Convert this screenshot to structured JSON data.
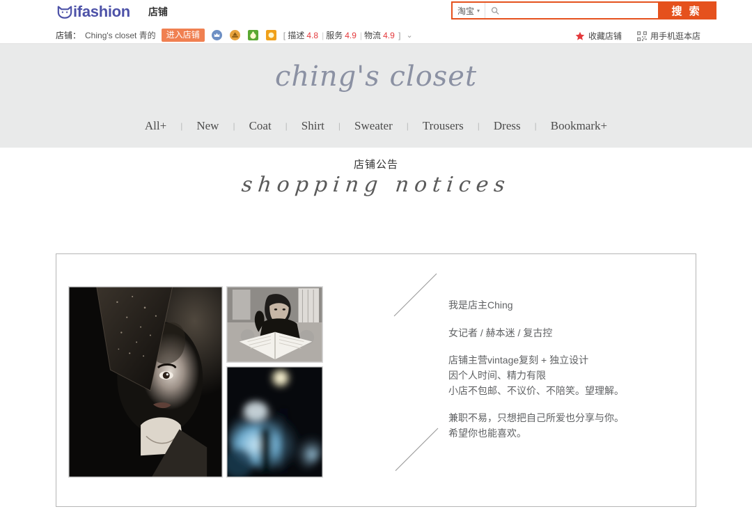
{
  "header": {
    "brand": {
      "name": "ifashion",
      "icon": "cat-face-icon",
      "color": "#4d52a8"
    },
    "shop_tab_label": "店铺",
    "shop_row": {
      "label": "店铺：",
      "name": "Ching's closet 青的",
      "enter_button": "进入店铺"
    },
    "badges": [
      {
        "name": "crown-badge",
        "color": "#6d8fc4"
      },
      {
        "name": "gold-seal-badge",
        "color": "#e8a33d"
      },
      {
        "name": "green-leaf-badge",
        "color": "#5aa832"
      },
      {
        "name": "orange-square-badge",
        "color": "#f0a019"
      }
    ],
    "ratings": {
      "open_bracket": "[",
      "close_bracket": "]",
      "items": [
        {
          "label": "描述",
          "value": "4.8"
        },
        {
          "label": "服务",
          "value": "4.9"
        },
        {
          "label": "物流",
          "value": "4.9"
        }
      ],
      "value_color": "#e4393c"
    },
    "expand_caret": "⌄",
    "search": {
      "category": "淘宝",
      "category_caret": "▾",
      "icon": "search-icon",
      "value": "",
      "placeholder": "",
      "button_label": "搜 索",
      "accent": "#e5511d"
    },
    "right_actions": [
      {
        "icon": "star-icon",
        "label": "收藏店铺"
      },
      {
        "icon": "qr-code-icon",
        "label": "用手机逛本店"
      }
    ]
  },
  "banner": {
    "logo_text": "ching's closet",
    "logo_color": "#8b91a3",
    "background": "#e9eaea",
    "nav": [
      {
        "label": "All+"
      },
      {
        "label": "New"
      },
      {
        "label": "Coat"
      },
      {
        "label": "Shirt"
      },
      {
        "label": "Sweater"
      },
      {
        "label": "Trousers"
      },
      {
        "label": "Dress"
      },
      {
        "label": "Bookmark+"
      }
    ],
    "nav_separator": "|"
  },
  "notice": {
    "title_cn": "店铺公告",
    "title_en": "shopping notices"
  },
  "panel": {
    "photos": [
      {
        "name": "portrait-veiled-hat-photo",
        "alt": "黑白肖像 戴纱帽"
      },
      {
        "name": "reading-book-photo",
        "alt": "黑白照片 阅读书籍"
      },
      {
        "name": "blue-bokeh-night-photo",
        "alt": "蓝色夜景虚焦照片"
      }
    ],
    "text": {
      "line1": "我是店主Ching",
      "line2": "女记者 / 赫本迷 / 复古控",
      "line3": "店铺主营vintage复刻 + 独立设计",
      "line4": "因个人时间、精力有限",
      "line5": "小店不包邮、不议价、不陪笑。望理解。",
      "line6": "兼职不易，只想把自己所爱也分享与你。",
      "line7": "希望你也能喜欢。"
    }
  }
}
